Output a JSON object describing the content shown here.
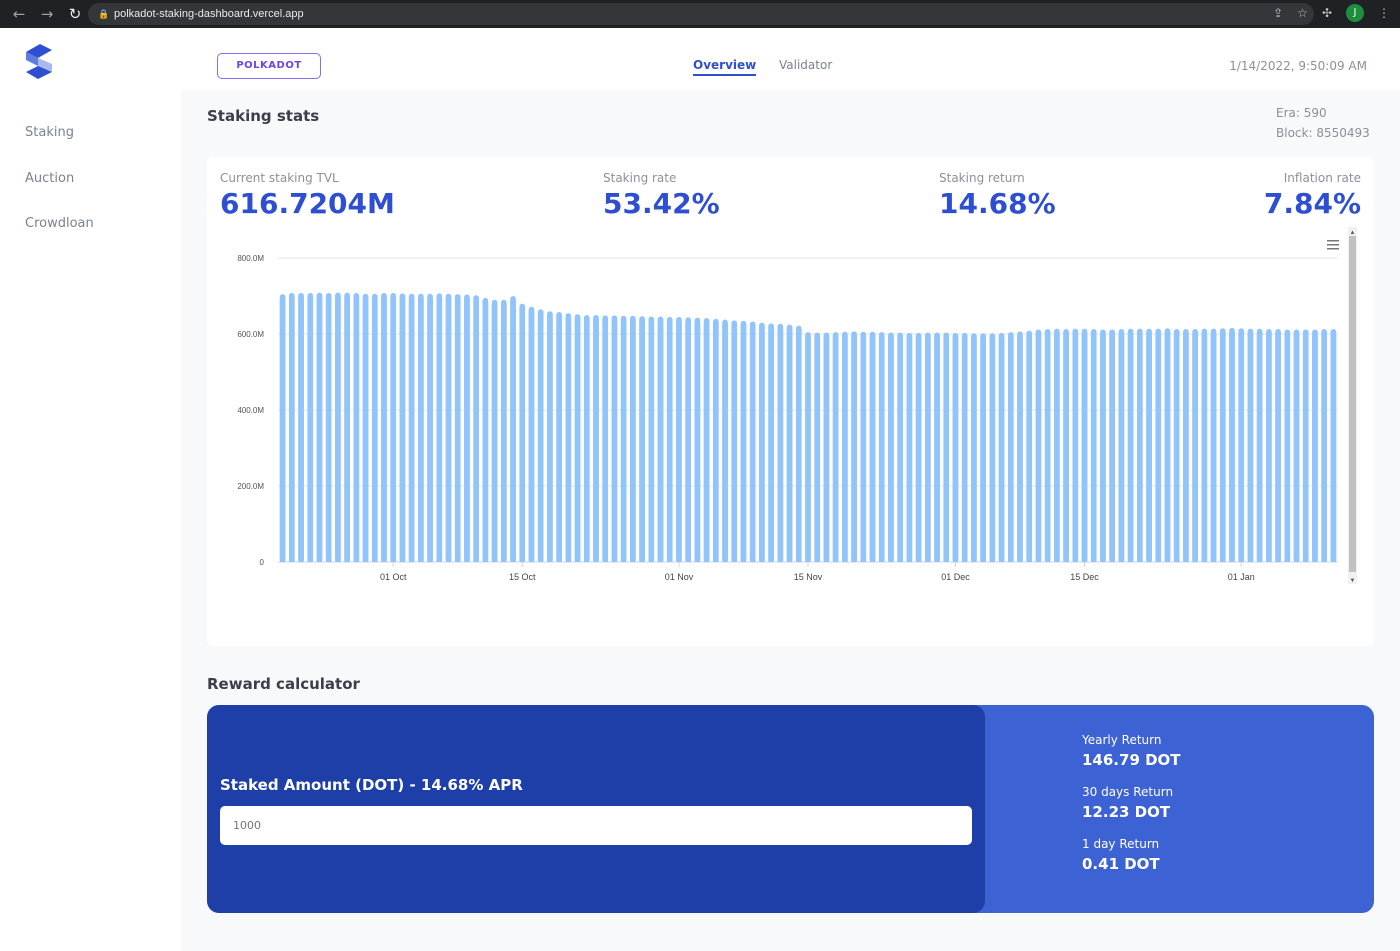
{
  "browser": {
    "url": "polkadot-staking-dashboard.vercel.app",
    "profile_initial": "J"
  },
  "sidebar": {
    "items": [
      {
        "label": "Staking"
      },
      {
        "label": "Auction"
      },
      {
        "label": "Crowdloan"
      }
    ]
  },
  "header": {
    "chain_button": "POLKADOT",
    "tabs": [
      {
        "label": "Overview",
        "active": true
      },
      {
        "label": "Validator",
        "active": false
      }
    ],
    "datetime": "1/14/2022, 9:50:09 AM"
  },
  "staking": {
    "title": "Staking stats",
    "era": "Era: 590",
    "block": "Block: 8550493",
    "stats": [
      {
        "label": "Current staking TVL",
        "value": "616.7204M"
      },
      {
        "label": "Staking rate",
        "value": "53.42%"
      },
      {
        "label": "Staking return",
        "value": "14.68%"
      },
      {
        "label": "Inflation rate",
        "value": "7.84%"
      }
    ]
  },
  "chart_data": {
    "type": "bar",
    "title": "",
    "xlabel": "",
    "ylabel": "",
    "ylim": [
      0,
      800
    ],
    "y_unit": "M",
    "grid": true,
    "color": "#90c4fa",
    "y_ticks": [
      "0",
      "200.0M",
      "400.0M",
      "600.0M",
      "800.0M"
    ],
    "x_ticks": [
      {
        "date": "2021-10-01",
        "label": "01 Oct"
      },
      {
        "date": "2021-10-15",
        "label": "15 Oct"
      },
      {
        "date": "2021-11-01",
        "label": "01 Nov"
      },
      {
        "date": "2021-11-15",
        "label": "15 Nov"
      },
      {
        "date": "2021-12-01",
        "label": "01 Dec"
      },
      {
        "date": "2021-12-15",
        "label": "15 Dec"
      },
      {
        "date": "2022-01-01",
        "label": "01 Jan"
      }
    ],
    "x_range": [
      "2021-09-19",
      "2022-01-11"
    ],
    "x_interval": "1 day",
    "values": [
      705,
      708,
      708,
      708,
      709,
      708,
      709,
      709,
      708,
      706,
      706,
      708,
      708,
      707,
      706,
      706,
      706,
      707,
      706,
      705,
      704,
      702,
      695,
      690,
      690,
      700,
      680,
      672,
      665,
      660,
      658,
      655,
      652,
      650,
      650,
      649,
      649,
      648,
      648,
      647,
      646,
      646,
      645,
      645,
      644,
      643,
      642,
      640,
      638,
      636,
      635,
      633,
      630,
      628,
      627,
      625,
      622,
      605,
      604,
      604,
      605,
      606,
      607,
      606,
      606,
      605,
      604,
      604,
      603,
      603,
      604,
      604,
      604,
      603,
      603,
      602,
      602,
      602,
      603,
      605,
      607,
      609,
      612,
      613,
      614,
      613,
      614,
      614,
      613,
      612,
      612,
      613,
      614,
      614,
      614,
      614,
      615,
      613,
      613,
      613,
      614,
      614,
      615,
      616,
      615,
      614,
      614,
      613,
      613,
      612,
      612,
      612,
      612,
      613,
      613
    ]
  },
  "calculator": {
    "title": "Reward calculator",
    "input_label": "Staked Amount (DOT) - 14.68% APR",
    "input_placeholder": "1000",
    "returns": [
      {
        "label": "Yearly Return",
        "value": "146.79 DOT"
      },
      {
        "label": "30 days Return",
        "value": "12.23 DOT"
      },
      {
        "label": "1 day Return",
        "value": "0.41 DOT"
      }
    ]
  },
  "colors": {
    "accent": "#2e4fd1",
    "calc_dark": "#1e3fa8",
    "calc_light": "#3d62d4",
    "bar": "#90c4fa"
  }
}
